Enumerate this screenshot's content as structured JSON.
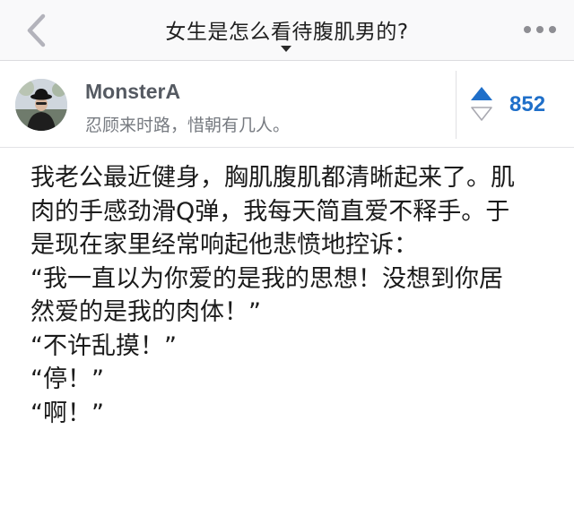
{
  "header": {
    "title": "女生是怎么看待腹肌男的?"
  },
  "author": {
    "name": "MonsterA",
    "bio": "忍顾来时路，惜朝有几人。"
  },
  "vote": {
    "count": "852"
  },
  "answer": {
    "lines": [
      "我老公最近健身，胸肌腹肌都清晰起来了。肌",
      "肉的手感劲滑Q弹，我每天简直爱不释手。于",
      "是现在家里经常响起他悲愤地控诉：",
      "“我一直以为你爱的是我的思想！没想到你居",
      "然爱的是我的肉体！”",
      "“不许乱摸！”",
      "“停！”",
      "“啊！”"
    ]
  },
  "colors": {
    "accent": "#1f6fc9",
    "back_arrow": "#b3b3bb",
    "nav_background": "#f9f9fa"
  },
  "icons": {
    "back": "chevron-left-icon",
    "more": "more-dots-icon",
    "upvote": "upvote-arrow-icon",
    "downvote": "downvote-arrow-icon"
  }
}
